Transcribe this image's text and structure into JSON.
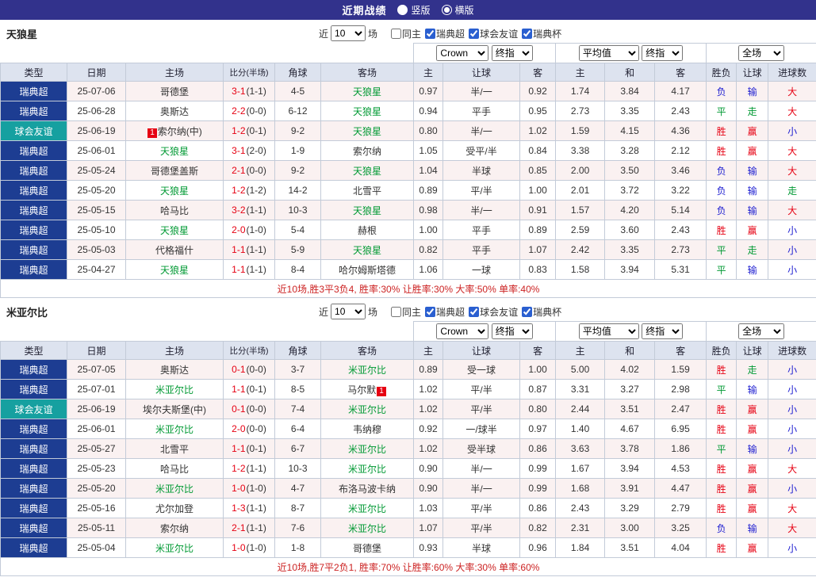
{
  "top_bar": {
    "title": "近期战绩",
    "view_options": [
      {
        "label": "竖版",
        "selected": false
      },
      {
        "label": "横版",
        "selected": true
      }
    ]
  },
  "filter": {
    "near_label": "近",
    "matches_count": "10",
    "games_label": "场",
    "checkboxes": [
      {
        "label": "同主",
        "checked": false
      },
      {
        "label": "瑞典超",
        "checked": true
      },
      {
        "label": "球会友谊",
        "checked": true
      },
      {
        "label": "瑞典杯",
        "checked": true
      }
    ]
  },
  "odds_dropdowns": {
    "bookmaker": "Crown",
    "final_index": "终指",
    "average": "平均值",
    "final_index_2": "终指",
    "full_match": "全场"
  },
  "table_headers": {
    "type": "类型",
    "date": "日期",
    "home": "主场",
    "score_half": "比分(半场)",
    "corners": "角球",
    "away": "客场",
    "odds_home": "主",
    "odds_handicap": "让球",
    "odds_away": "客",
    "avg_home": "主",
    "avg_draw": "和",
    "avg_away": "客",
    "result": "胜负",
    "handicap_result": "让球",
    "goals_result": "进球数"
  },
  "type_colors": {
    "瑞典超": "#1d3d92",
    "球会友谊": "#16a0a0"
  },
  "result_colors": {
    "胜": "#e60012",
    "赢": "#e60012",
    "大": "#e60012",
    "平": "#009933",
    "走": "#009933",
    "负": "#1c1cd0",
    "输": "#1c1cd0",
    "小": "#1c1cd0"
  },
  "focus_team_color": "#009933",
  "score_color": "#e60012",
  "summary_color": "#cc2222",
  "sections": [
    {
      "team": "天狼星",
      "rows": [
        {
          "league": "瑞典超",
          "date": "25-07-06",
          "home": "哥德堡",
          "score": "3-1",
          "half": "(1-1)",
          "corners": "4-5",
          "away": "天狼星",
          "o1": "0.97",
          "o2": "半/一",
          "o3": "0.92",
          "a1": "1.74",
          "a2": "3.84",
          "a3": "4.17",
          "r1": "负",
          "r2": "输",
          "r3": "大"
        },
        {
          "league": "瑞典超",
          "date": "25-06-28",
          "home": "奥斯达",
          "score": "2-2",
          "half": "(0-0)",
          "corners": "6-12",
          "away": "天狼星",
          "o1": "0.94",
          "o2": "平手",
          "o3": "0.95",
          "a1": "2.73",
          "a2": "3.35",
          "a3": "2.43",
          "r1": "平",
          "r2": "走",
          "r3": "大"
        },
        {
          "league": "球会友谊",
          "date": "25-06-19",
          "home": "索尔纳(中)",
          "home_card": "1",
          "home_card_pos": "before",
          "score": "1-2",
          "half": "(0-1)",
          "corners": "9-2",
          "away": "天狼星",
          "o1": "0.80",
          "o2": "半/一",
          "o3": "1.02",
          "a1": "1.59",
          "a2": "4.15",
          "a3": "4.36",
          "r1": "胜",
          "r2": "赢",
          "r3": "小"
        },
        {
          "league": "瑞典超",
          "date": "25-06-01",
          "home": "天狼星",
          "score": "3-1",
          "half": "(2-0)",
          "corners": "1-9",
          "away": "索尔纳",
          "o1": "1.05",
          "o2": "受平/半",
          "o3": "0.84",
          "a1": "3.38",
          "a2": "3.28",
          "a3": "2.12",
          "r1": "胜",
          "r2": "赢",
          "r3": "大"
        },
        {
          "league": "瑞典超",
          "date": "25-05-24",
          "home": "哥德堡盖斯",
          "score": "2-1",
          "half": "(0-0)",
          "corners": "9-2",
          "away": "天狼星",
          "o1": "1.04",
          "o2": "半球",
          "o3": "0.85",
          "a1": "2.00",
          "a2": "3.50",
          "a3": "3.46",
          "r1": "负",
          "r2": "输",
          "r3": "大"
        },
        {
          "league": "瑞典超",
          "date": "25-05-20",
          "home": "天狼星",
          "score": "1-2",
          "half": "(1-2)",
          "corners": "14-2",
          "away": "北雪平",
          "o1": "0.89",
          "o2": "平/半",
          "o3": "1.00",
          "a1": "2.01",
          "a2": "3.72",
          "a3": "3.22",
          "r1": "负",
          "r2": "输",
          "r3": "走"
        },
        {
          "league": "瑞典超",
          "date": "25-05-15",
          "home": "哈马比",
          "score": "3-2",
          "half": "(1-1)",
          "corners": "10-3",
          "away": "天狼星",
          "o1": "0.98",
          "o2": "半/一",
          "o3": "0.91",
          "a1": "1.57",
          "a2": "4.20",
          "a3": "5.14",
          "r1": "负",
          "r2": "输",
          "r3": "大"
        },
        {
          "league": "瑞典超",
          "date": "25-05-10",
          "home": "天狼星",
          "score": "2-0",
          "half": "(1-0)",
          "corners": "5-4",
          "away": "赫根",
          "o1": "1.00",
          "o2": "平手",
          "o3": "0.89",
          "a1": "2.59",
          "a2": "3.60",
          "a3": "2.43",
          "r1": "胜",
          "r2": "赢",
          "r3": "小"
        },
        {
          "league": "瑞典超",
          "date": "25-05-03",
          "home": "代格福什",
          "score": "1-1",
          "half": "(1-1)",
          "corners": "5-9",
          "away": "天狼星",
          "o1": "0.82",
          "o2": "平手",
          "o3": "1.07",
          "a1": "2.42",
          "a2": "3.35",
          "a3": "2.73",
          "r1": "平",
          "r2": "走",
          "r3": "小"
        },
        {
          "league": "瑞典超",
          "date": "25-04-27",
          "home": "天狼星",
          "score": "1-1",
          "half": "(1-1)",
          "corners": "8-4",
          "away": "哈尔姆斯塔德",
          "o1": "1.06",
          "o2": "一球",
          "o3": "0.83",
          "a1": "1.58",
          "a2": "3.94",
          "a3": "5.31",
          "r1": "平",
          "r2": "输",
          "r3": "小"
        }
      ],
      "summary": "近10场,胜3平3负4, 胜率:30% 让胜率:30% 大率:50% 单率:40%"
    },
    {
      "team": "米亚尔比",
      "rows": [
        {
          "league": "瑞典超",
          "date": "25-07-05",
          "home": "奥斯达",
          "score": "0-1",
          "half": "(0-0)",
          "corners": "3-7",
          "away": "米亚尔比",
          "o1": "0.89",
          "o2": "受一球",
          "o3": "1.00",
          "a1": "5.00",
          "a2": "4.02",
          "a3": "1.59",
          "r1": "胜",
          "r2": "走",
          "r3": "小"
        },
        {
          "league": "瑞典超",
          "date": "25-07-01",
          "home": "米亚尔比",
          "score": "1-1",
          "half": "(0-1)",
          "corners": "8-5",
          "away": "马尔默",
          "away_card": "1",
          "away_card_pos": "after",
          "o1": "1.02",
          "o2": "平/半",
          "o3": "0.87",
          "a1": "3.31",
          "a2": "3.27",
          "a3": "2.98",
          "r1": "平",
          "r2": "输",
          "r3": "小"
        },
        {
          "league": "球会友谊",
          "date": "25-06-19",
          "home": "埃尔夫斯堡(中)",
          "score": "0-1",
          "half": "(0-0)",
          "corners": "7-4",
          "away": "米亚尔比",
          "o1": "1.02",
          "o2": "平/半",
          "o3": "0.80",
          "a1": "2.44",
          "a2": "3.51",
          "a3": "2.47",
          "r1": "胜",
          "r2": "赢",
          "r3": "小"
        },
        {
          "league": "瑞典超",
          "date": "25-06-01",
          "home": "米亚尔比",
          "score": "2-0",
          "half": "(0-0)",
          "corners": "6-4",
          "away": "韦纳穆",
          "o1": "0.92",
          "o2": "一/球半",
          "o3": "0.97",
          "a1": "1.40",
          "a2": "4.67",
          "a3": "6.95",
          "r1": "胜",
          "r2": "赢",
          "r3": "小"
        },
        {
          "league": "瑞典超",
          "date": "25-05-27",
          "home": "北雪平",
          "score": "1-1",
          "half": "(0-1)",
          "corners": "6-7",
          "away": "米亚尔比",
          "o1": "1.02",
          "o2": "受半球",
          "o3": "0.86",
          "a1": "3.63",
          "a2": "3.78",
          "a3": "1.86",
          "r1": "平",
          "r2": "输",
          "r3": "小"
        },
        {
          "league": "瑞典超",
          "date": "25-05-23",
          "home": "哈马比",
          "score": "1-2",
          "half": "(1-1)",
          "corners": "10-3",
          "away": "米亚尔比",
          "o1": "0.90",
          "o2": "半/一",
          "o3": "0.99",
          "a1": "1.67",
          "a2": "3.94",
          "a3": "4.53",
          "r1": "胜",
          "r2": "赢",
          "r3": "大"
        },
        {
          "league": "瑞典超",
          "date": "25-05-20",
          "home": "米亚尔比",
          "score": "1-0",
          "half": "(1-0)",
          "corners": "4-7",
          "away": "布洛马波卡纳",
          "o1": "0.90",
          "o2": "半/一",
          "o3": "0.99",
          "a1": "1.68",
          "a2": "3.91",
          "a3": "4.47",
          "r1": "胜",
          "r2": "赢",
          "r3": "小"
        },
        {
          "league": "瑞典超",
          "date": "25-05-16",
          "home": "尤尔加登",
          "score": "1-3",
          "half": "(1-1)",
          "corners": "8-7",
          "away": "米亚尔比",
          "o1": "1.03",
          "o2": "平/半",
          "o3": "0.86",
          "a1": "2.43",
          "a2": "3.29",
          "a3": "2.79",
          "r1": "胜",
          "r2": "赢",
          "r3": "大"
        },
        {
          "league": "瑞典超",
          "date": "25-05-11",
          "home": "索尔纳",
          "score": "2-1",
          "half": "(1-1)",
          "corners": "7-6",
          "away": "米亚尔比",
          "o1": "1.07",
          "o2": "平/半",
          "o3": "0.82",
          "a1": "2.31",
          "a2": "3.00",
          "a3": "3.25",
          "r1": "负",
          "r2": "输",
          "r3": "大"
        },
        {
          "league": "瑞典超",
          "date": "25-05-04",
          "home": "米亚尔比",
          "score": "1-0",
          "half": "(1-0)",
          "corners": "1-8",
          "away": "哥德堡",
          "o1": "0.93",
          "o2": "半球",
          "o3": "0.96",
          "a1": "1.84",
          "a2": "3.51",
          "a3": "4.04",
          "r1": "胜",
          "r2": "赢",
          "r3": "小"
        }
      ],
      "summary": "近10场,胜7平2负1, 胜率:70% 让胜率:60% 大率:30% 单率:60%"
    }
  ]
}
